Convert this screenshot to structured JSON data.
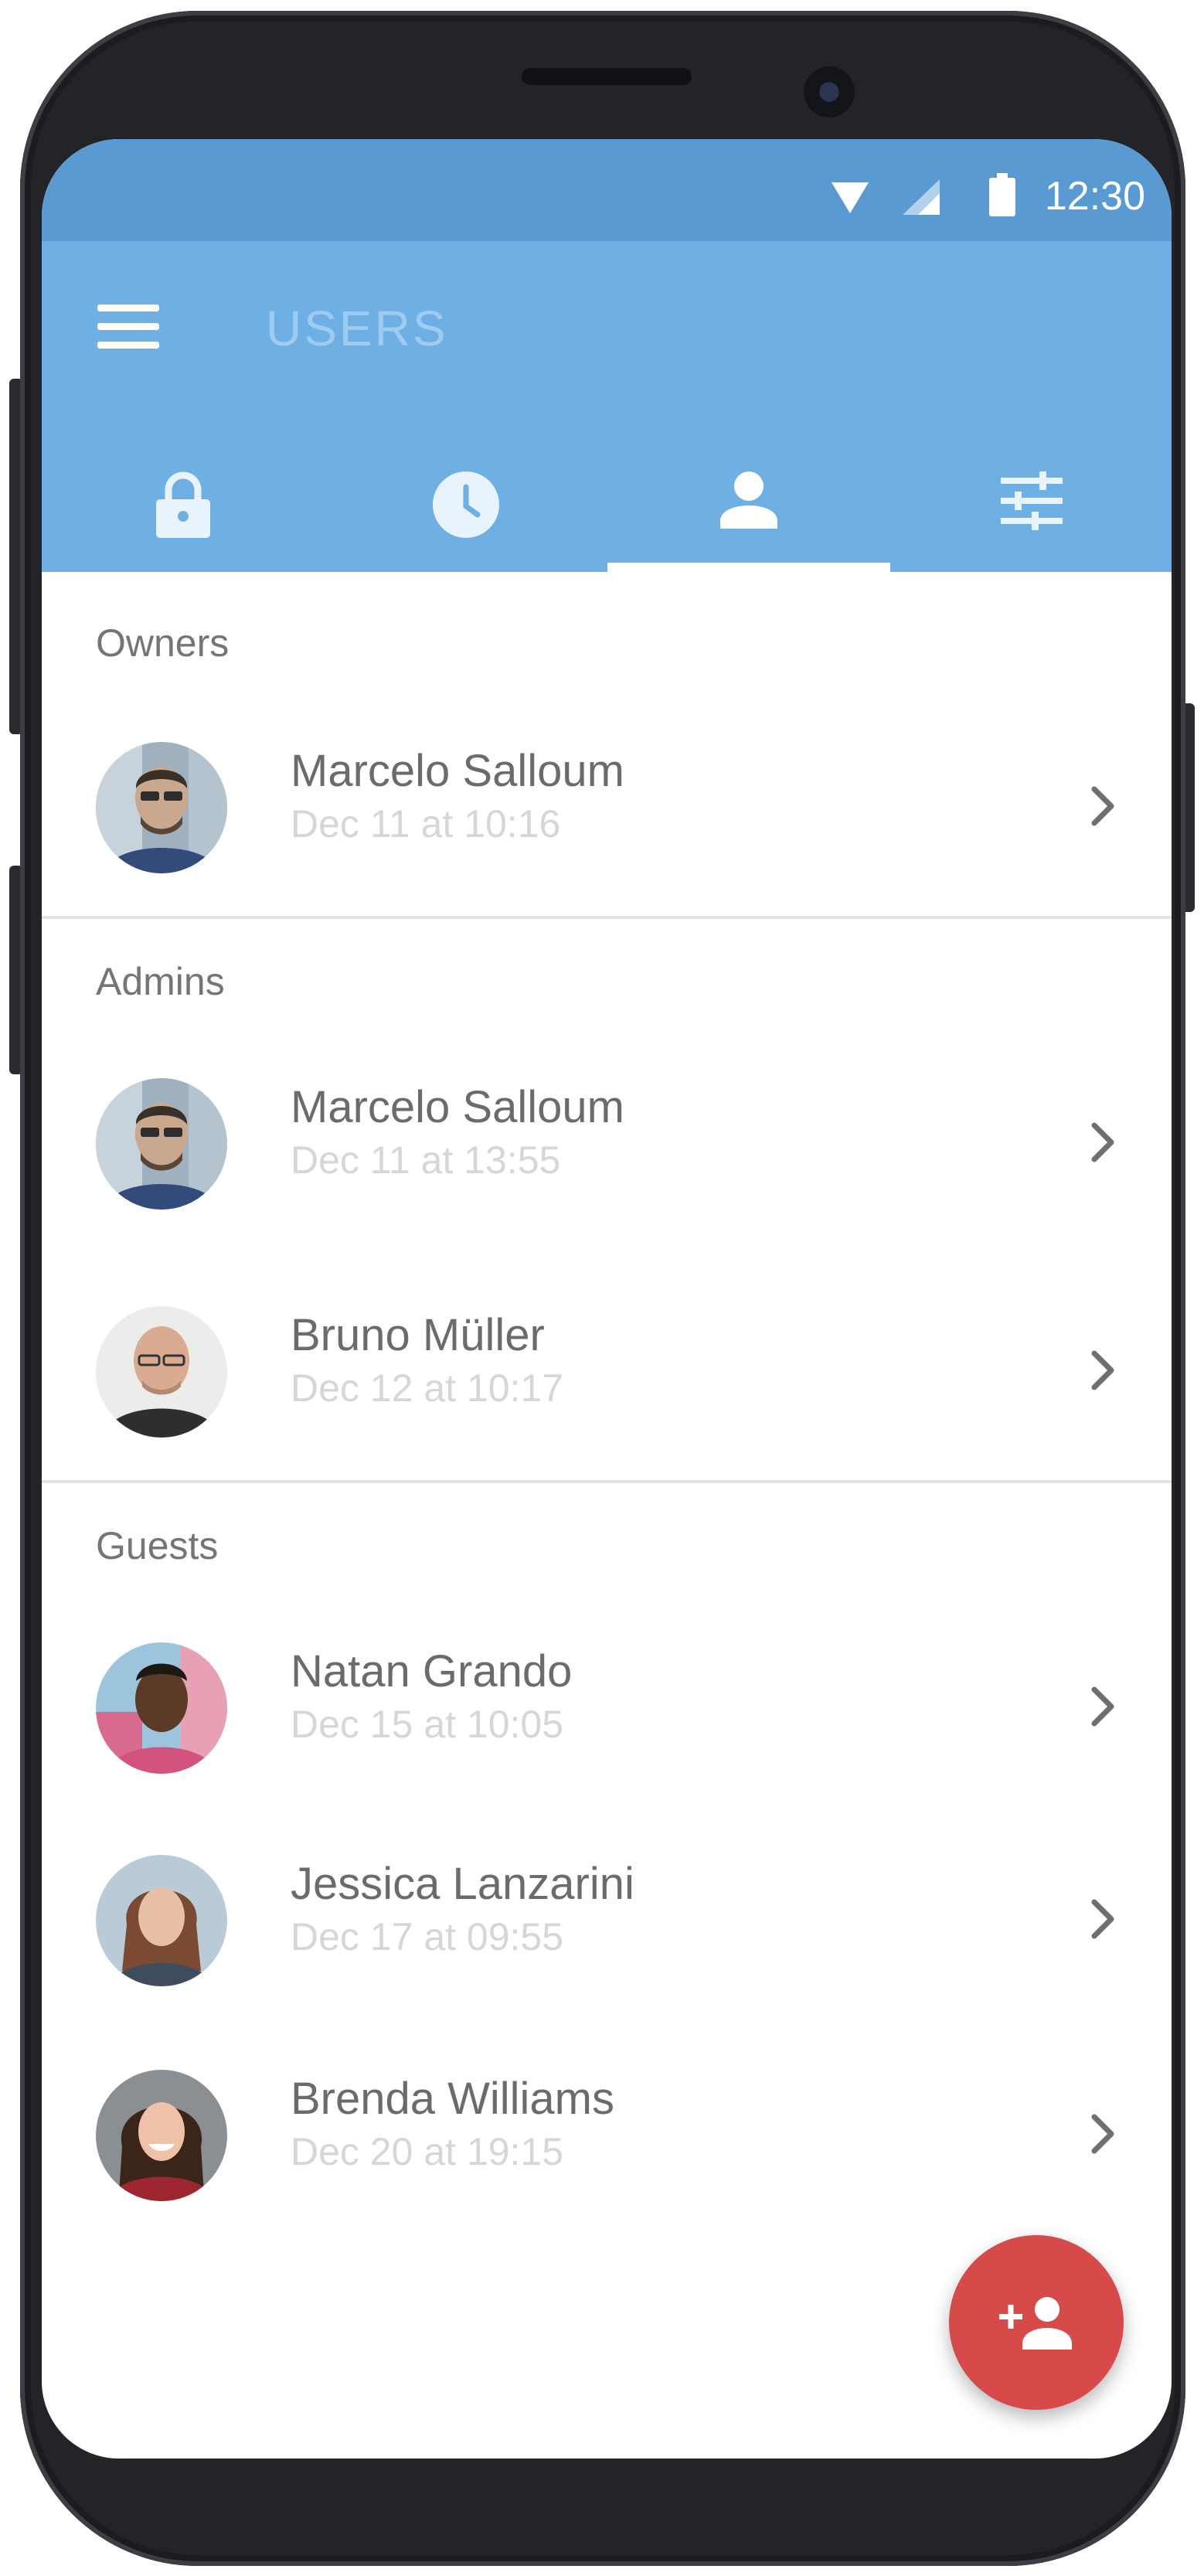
{
  "status_bar": {
    "time": "12:30",
    "icons": [
      "wifi-icon",
      "cell-signal-icon",
      "battery-icon"
    ]
  },
  "app_bar": {
    "title": "USERS",
    "menu_icon": "menu-icon",
    "tabs": [
      {
        "icon": "lock-icon",
        "active": false
      },
      {
        "icon": "clock-icon",
        "active": false
      },
      {
        "icon": "person-icon",
        "active": true
      },
      {
        "icon": "sliders-icon",
        "active": false
      }
    ]
  },
  "sections": {
    "owners": {
      "header": "Owners",
      "users": [
        {
          "name": "Marcelo Salloum",
          "last_seen": "Dec 11 at 10:16"
        }
      ]
    },
    "admins": {
      "header": "Admins",
      "users": [
        {
          "name": "Marcelo Salloum",
          "last_seen": "Dec 11 at 13:55"
        },
        {
          "name": "Bruno Müller",
          "last_seen": "Dec 12 at 10:17"
        }
      ]
    },
    "guests": {
      "header": "Guests",
      "users": [
        {
          "name": "Natan Grando",
          "last_seen": "Dec 15 at 10:05"
        },
        {
          "name": "Jessica Lanzarini",
          "last_seen": "Dec 17 at 09:55"
        },
        {
          "name": "Brenda Williams",
          "last_seen": "Dec 20 at 19:15"
        }
      ]
    }
  },
  "fab": {
    "icon": "add-user-icon"
  },
  "colors": {
    "status_bar": "#5a9ad3",
    "app_bar": "#6fb0e4",
    "fab": "#d64a4a",
    "name_text": "#6b6b6b",
    "time_text": "#d6d6d6",
    "section_text": "#757575"
  }
}
